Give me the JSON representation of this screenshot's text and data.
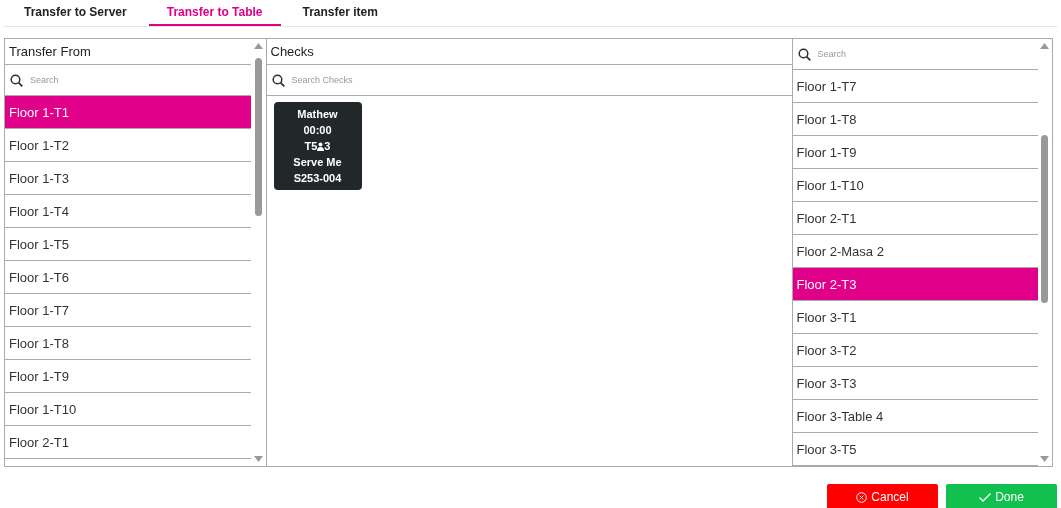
{
  "tabs": [
    {
      "label": "Transfer to Server",
      "selected": false
    },
    {
      "label": "Transfer to Table",
      "selected": true
    },
    {
      "label": "Transfer item",
      "selected": false
    }
  ],
  "from_panel": {
    "title": "Transfer From",
    "search": {
      "placeholder": "Search"
    },
    "items": [
      {
        "label": "Floor 1-T1",
        "selected": true
      },
      {
        "label": "Floor 1-T2",
        "selected": false
      },
      {
        "label": "Floor 1-T3",
        "selected": false
      },
      {
        "label": "Floor 1-T4",
        "selected": false
      },
      {
        "label": "Floor 1-T5",
        "selected": false
      },
      {
        "label": "Floor 1-T6",
        "selected": false
      },
      {
        "label": "Floor 1-T7",
        "selected": false
      },
      {
        "label": "Floor 1-T8",
        "selected": false
      },
      {
        "label": "Floor 1-T9",
        "selected": false
      },
      {
        "label": "Floor 1-T10",
        "selected": false
      },
      {
        "label": "Floor 2-T1",
        "selected": false
      }
    ]
  },
  "checks_panel": {
    "title": "Checks",
    "search": {
      "placeholder": "Search Checks"
    },
    "checks": [
      {
        "server": "Mathew",
        "time": "00:00",
        "table": "T5",
        "guests": "3",
        "status": "Serve Me",
        "number": "S253-004"
      }
    ]
  },
  "to_panel": {
    "search": {
      "placeholder": "Search"
    },
    "items": [
      {
        "label": "Floor 1-T7",
        "selected": false
      },
      {
        "label": "Floor 1-T8",
        "selected": false
      },
      {
        "label": "Floor 1-T9",
        "selected": false
      },
      {
        "label": "Floor 1-T10",
        "selected": false
      },
      {
        "label": "Floor 2-T1",
        "selected": false
      },
      {
        "label": "Floor 2-Masa 2",
        "selected": false
      },
      {
        "label": "Floor 2-T3",
        "selected": true
      },
      {
        "label": "Floor 3-T1",
        "selected": false
      },
      {
        "label": "Floor 3-T2",
        "selected": false
      },
      {
        "label": "Floor 3-T3",
        "selected": false
      },
      {
        "label": "Floor 3-Table 4",
        "selected": false
      },
      {
        "label": "Floor 3-T5",
        "selected": false
      }
    ]
  },
  "buttons": [
    {
      "kind": "cancel",
      "label": "Cancel"
    },
    {
      "kind": "done",
      "label": "Done"
    }
  ]
}
